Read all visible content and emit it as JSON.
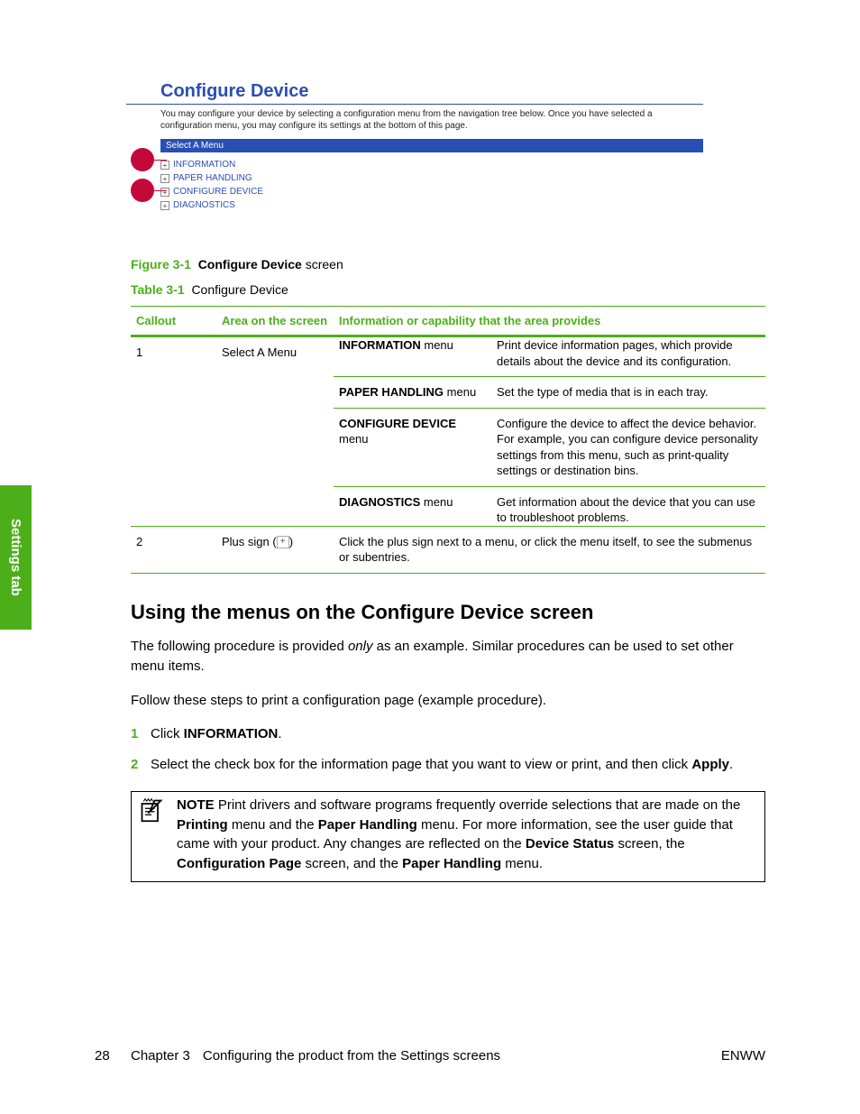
{
  "sideTab": "Settings tab",
  "screenshot": {
    "title": "Configure Device",
    "desc": "You may configure your device by selecting a configuration menu from the navigation tree below. Once you have selected a configuration menu, you may configure its settings at the bottom of this page.",
    "bar": "Select A Menu",
    "tree": [
      "INFORMATION",
      "PAPER HANDLING",
      "CONFIGURE DEVICE",
      "DIAGNOSTICS"
    ]
  },
  "figure": {
    "num": "Figure 3-1",
    "boldTitle": "Configure Device",
    "rest": " screen"
  },
  "tableCap": {
    "num": "Table 3-1",
    "rest": "Configure Device"
  },
  "tableHead": [
    "Callout",
    "Area on the screen",
    "Information or capability that the area provides"
  ],
  "row1": {
    "callout": "1",
    "area": "Select A Menu",
    "menus": [
      {
        "name": "INFORMATION",
        "suffix": " menu",
        "desc": "Print device information pages, which provide details about the device and its configuration."
      },
      {
        "name": "PAPER HANDLING",
        "suffix": " menu",
        "desc": "Set the type of media that is in each tray."
      },
      {
        "name": "CONFIGURE DEVICE",
        "suffix": " menu",
        "desc": "Configure the device to affect the device behavior. For example, you can configure device personality settings from this menu, such as print-quality settings or destination bins."
      },
      {
        "name": "DIAGNOSTICS",
        "suffix": " menu",
        "desc": "Get information about the device that you can use to troubleshoot problems."
      }
    ]
  },
  "row2": {
    "callout": "2",
    "areaPrefix": "Plus sign (",
    "areaSuffix": ")",
    "desc": "Click the plus sign next to a menu, or click the menu itself, to see the submenus or subentries."
  },
  "sectionHeading": "Using the menus on the Configure Device screen",
  "para1a": "The following procedure is provided ",
  "para1em": "only",
  "para1b": " as an example. Similar procedures can be used to set other menu items.",
  "para2": "Follow these steps to print a configuration page (example procedure).",
  "steps": {
    "s1a": "Click ",
    "s1b": "INFORMATION",
    "s1c": ".",
    "s2a": "Select the check box for the information page that you want to view or print, and then click ",
    "s2b": "Apply",
    "s2c": "."
  },
  "note": {
    "label": "NOTE",
    "t1": "   Print drivers and software programs frequently override selections that are made on the ",
    "b1": "Printing",
    "t2": " menu and the ",
    "b2": "Paper Handling",
    "t3": " menu. For more information, see the user guide that came with your product. Any changes are reflected on the ",
    "b3": "Device Status",
    "t4": " screen, the ",
    "b4": "Configuration Page",
    "t5": " screen, and the ",
    "b5": "Paper Handling",
    "t6": " menu."
  },
  "footer": {
    "page": "28",
    "chapter": "Chapter 3",
    "title": "Configuring the product from the Settings screens",
    "right": "ENWW"
  }
}
